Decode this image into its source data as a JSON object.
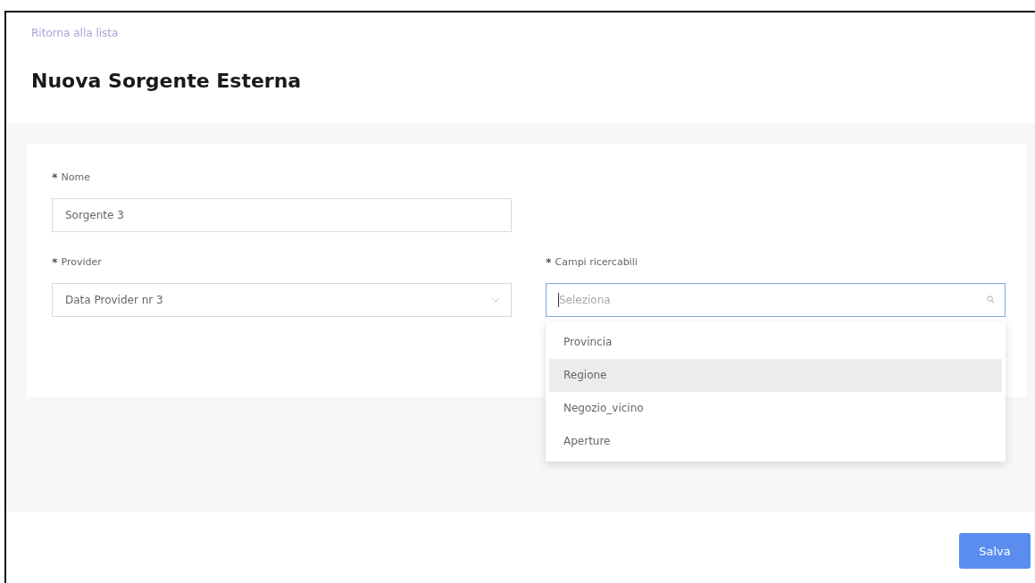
{
  "back_link": "Ritorna alla lista",
  "title": "Nuova Sorgente Esterna",
  "fields": [
    {
      "kind": "text",
      "required_mark": "*",
      "label": "Nome",
      "value": "Sorgente 3"
    },
    {
      "kind": "select",
      "required_mark": "*",
      "label": "Provider",
      "value": "Data Provider nr 3"
    },
    {
      "kind": "search",
      "required_mark": "*",
      "label": "Campi ricercabili",
      "placeholder": "Seleziona",
      "focused": true,
      "options": [
        {
          "label": "Provincia",
          "highlighted": false
        },
        {
          "label": "Regione",
          "highlighted": true
        },
        {
          "label": "Negozio_vicino",
          "highlighted": false
        },
        {
          "label": "Aperture",
          "highlighted": false
        }
      ]
    }
  ],
  "save_button": "Salva"
}
